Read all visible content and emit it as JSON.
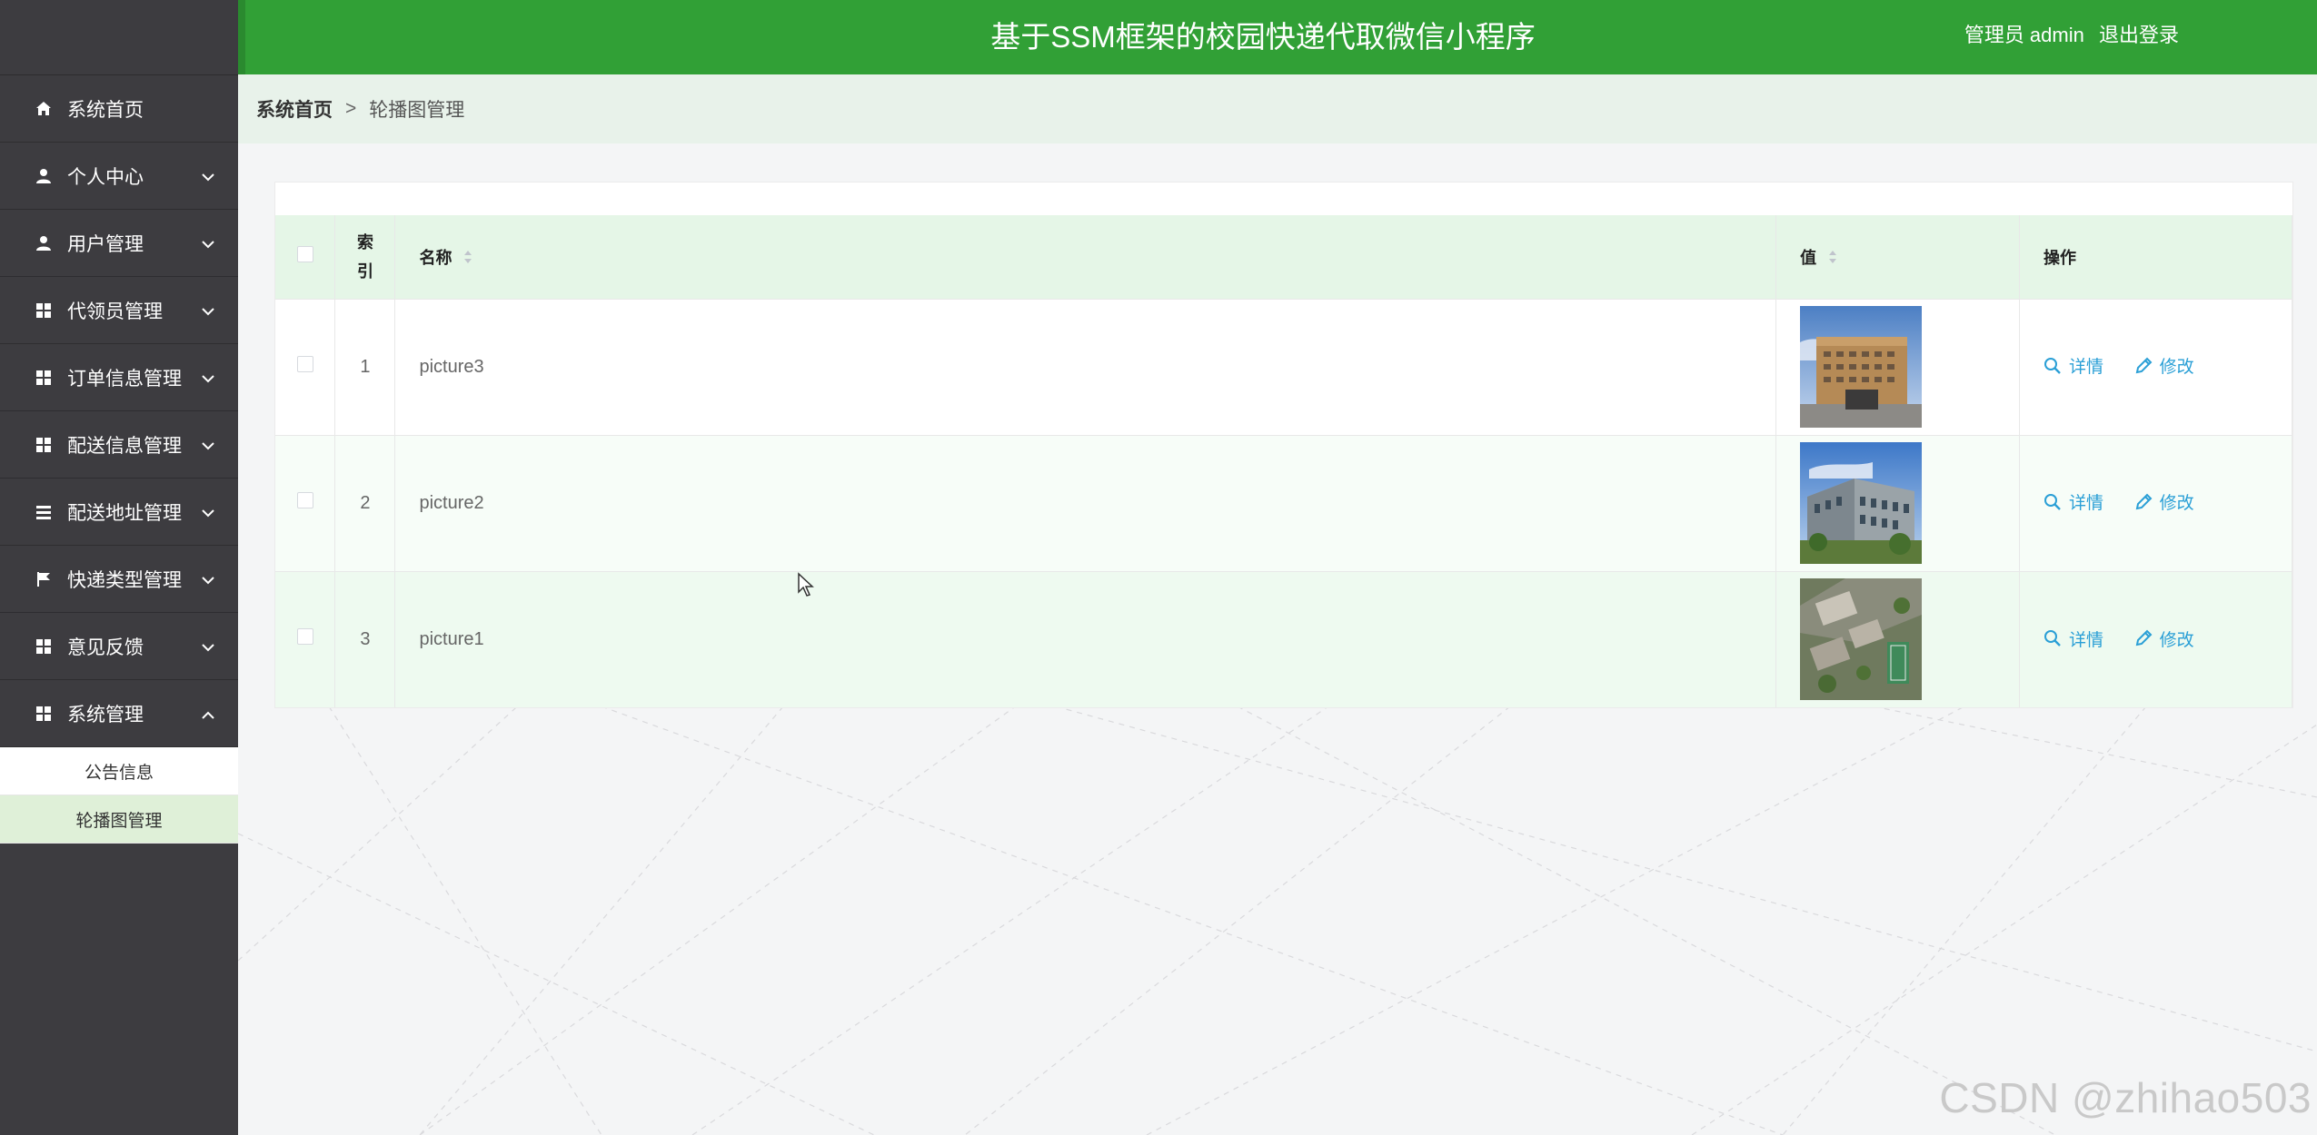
{
  "header": {
    "title": "基于SSM框架的校园快递代取微信小程序",
    "admin_label": "管理员 admin",
    "logout_label": "退出登录"
  },
  "sidebar": {
    "items": [
      {
        "label": "系统首页",
        "icon": "home-icon"
      },
      {
        "label": "个人中心",
        "icon": "user-icon"
      },
      {
        "label": "用户管理",
        "icon": "user-icon"
      },
      {
        "label": "代领员管理",
        "icon": "grid-icon"
      },
      {
        "label": "订单信息管理",
        "icon": "grid-icon"
      },
      {
        "label": "配送信息管理",
        "icon": "grid-icon"
      },
      {
        "label": "配送地址管理",
        "icon": "list-icon"
      },
      {
        "label": "快递类型管理",
        "icon": "flag-icon"
      },
      {
        "label": "意见反馈",
        "icon": "grid-icon"
      },
      {
        "label": "系统管理",
        "icon": "grid-icon"
      }
    ],
    "submenu": [
      {
        "label": "公告信息"
      },
      {
        "label": "轮播图管理"
      }
    ]
  },
  "breadcrumb": {
    "home": "系统首页",
    "separator": ">",
    "current": "轮播图管理"
  },
  "table": {
    "columns": {
      "index": "索引",
      "name": "名称",
      "value": "值",
      "actions": "操作"
    },
    "rows": [
      {
        "index": "1",
        "name": "picture3",
        "image": "building-photo-1"
      },
      {
        "index": "2",
        "name": "picture2",
        "image": "building-photo-2"
      },
      {
        "index": "3",
        "name": "picture1",
        "image": "campus-aerial-photo"
      }
    ],
    "detail_label": "详情",
    "edit_label": "修改"
  },
  "watermark": "CSDN @zhihao503",
  "colors": {
    "header_green": "#31a036",
    "sidebar_dark": "#3d3c40",
    "action_blue": "#2a9fd6",
    "table_header_bg": "#e5f6e7"
  }
}
